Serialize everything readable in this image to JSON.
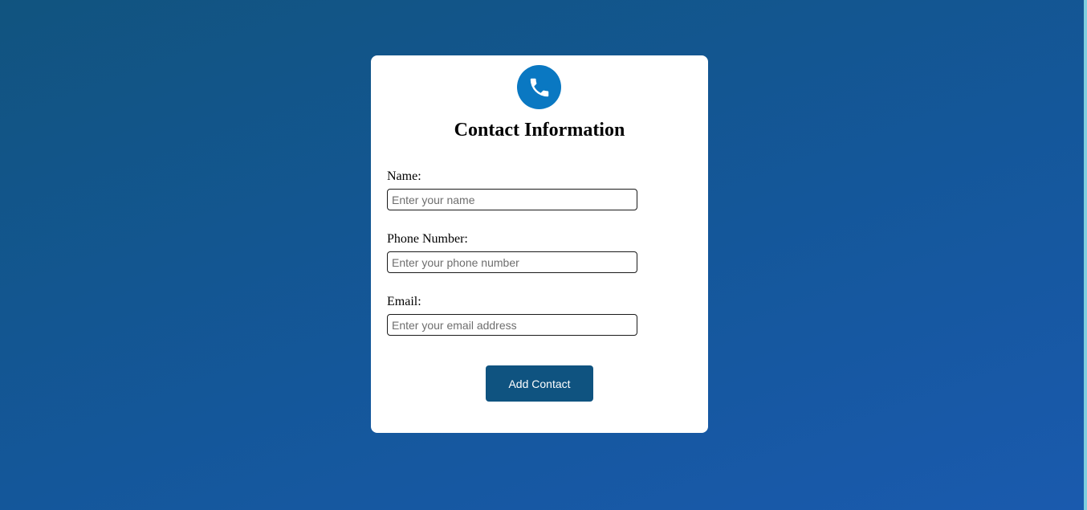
{
  "card": {
    "title": "Contact Information",
    "icon": "phone-icon"
  },
  "form": {
    "name": {
      "label": "Name:",
      "placeholder": "Enter your name",
      "value": ""
    },
    "phone": {
      "label": "Phone Number:",
      "placeholder": "Enter your phone number",
      "value": ""
    },
    "email": {
      "label": "Email:",
      "placeholder": "Enter your email address",
      "value": ""
    },
    "submit_label": "Add Contact"
  },
  "colors": {
    "background_start": "#11547f",
    "background_end": "#1a5aae",
    "icon_circle": "#0a78c2",
    "button": "#0f5380",
    "card": "#ffffff"
  }
}
